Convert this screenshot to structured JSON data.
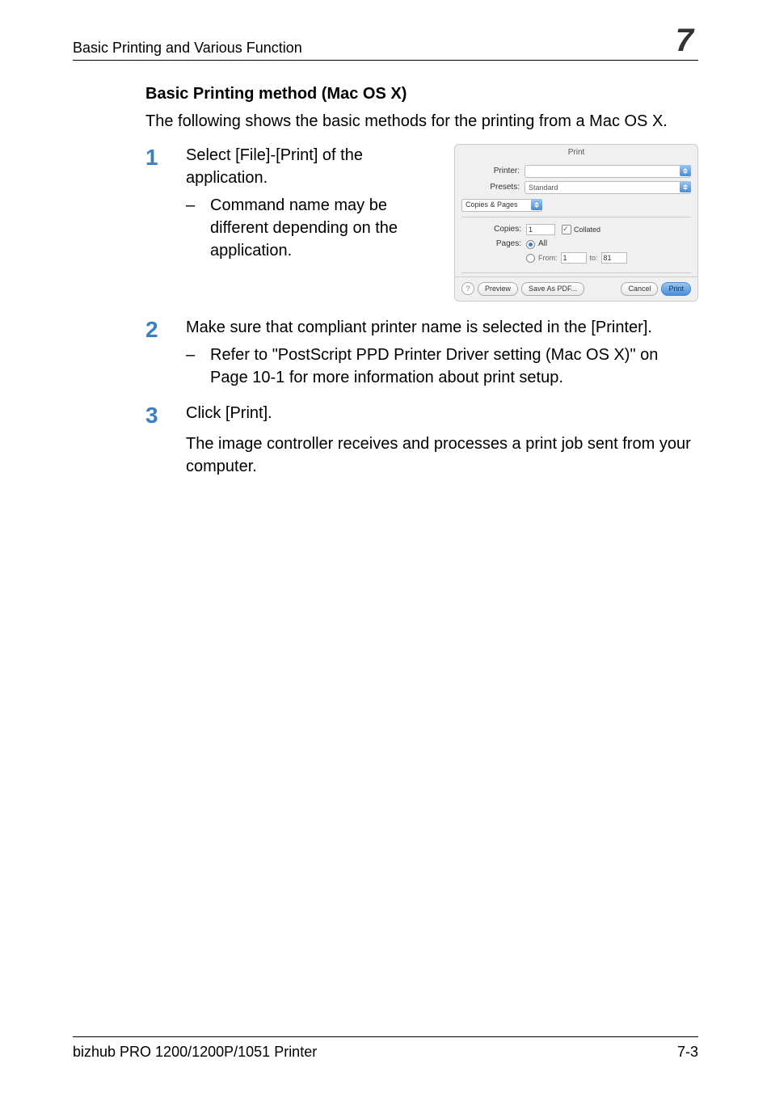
{
  "header": {
    "title": "Basic Printing and Various Function",
    "chapter": "7"
  },
  "section_heading": "Basic Printing method (Mac OS X)",
  "intro": "The following shows the basic methods for the printing from a Mac OS X.",
  "steps": [
    {
      "num": "1",
      "text": "Select [File]-[Print] of the application.",
      "bullets": [
        "Command name may be different depending on the application."
      ]
    },
    {
      "num": "2",
      "text": "Make sure that compliant printer name is selected in the [Printer].",
      "bullets": [
        "Refer to \"PostScript PPD Printer Driver setting (Mac OS X)\" on Page 10-1 for more information about print setup."
      ]
    },
    {
      "num": "3",
      "text": "Click [Print].",
      "result": "The image controller receives and processes a print job sent from your computer."
    }
  ],
  "dialog": {
    "title": "Print",
    "printer_label": "Printer:",
    "printer_value": "",
    "presets_label": "Presets:",
    "presets_value": "Standard",
    "section_select": "Copies & Pages",
    "copies_label": "Copies:",
    "copies_value": "1",
    "collated_label": "Collated",
    "pages_label": "Pages:",
    "pages_all": "All",
    "pages_from": "From:",
    "pages_from_value": "1",
    "pages_to": "to:",
    "pages_to_value": "81",
    "help_char": "?",
    "preview_btn": "Preview",
    "save_pdf_btn": "Save As PDF...",
    "cancel_btn": "Cancel",
    "print_btn": "Print"
  },
  "footer": {
    "left": "bizhub PRO 1200/1200P/1051 Printer",
    "right": "7-3"
  }
}
